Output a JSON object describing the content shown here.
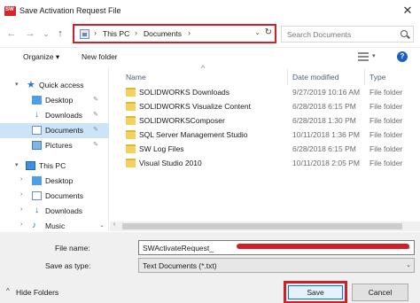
{
  "window": {
    "title": "Save Activation Request File",
    "close_glyph": "✕"
  },
  "nav": {
    "back_glyph": "←",
    "forward_glyph": "→",
    "dropdown_glyph": "⌄",
    "up_glyph": "↑",
    "breadcrumb": [
      "This PC",
      "Documents"
    ],
    "sep_glyph": "›",
    "refresh_glyph": "↻",
    "search_placeholder": "Search Documents"
  },
  "toolbar": {
    "organize_label": "Organize ▾",
    "new_folder_label": "New folder",
    "view_dd": "▾",
    "help_glyph": "?"
  },
  "sidebar": {
    "items": [
      {
        "label": "Quick access",
        "icon": "star-icon",
        "arrow": "▾"
      },
      {
        "label": "Desktop",
        "icon": "desktop-icon",
        "pin": "✎"
      },
      {
        "label": "Downloads",
        "icon": "download-icon",
        "pin": "✎"
      },
      {
        "label": "Documents",
        "icon": "documents-icon",
        "pin": "✎"
      },
      {
        "label": "Pictures",
        "icon": "pictures-icon",
        "pin": "✎"
      },
      {
        "label": "This PC",
        "icon": "computer-icon",
        "arrow": "▾"
      },
      {
        "label": "Desktop",
        "icon": "desktop-icon",
        "arrow": "›"
      },
      {
        "label": "Documents",
        "icon": "documents-icon",
        "arrow": "›"
      },
      {
        "label": "Downloads",
        "icon": "download-icon",
        "arrow": "›"
      },
      {
        "label": "Music",
        "icon": "music-icon",
        "arrow": "›"
      }
    ],
    "scroll_down_glyph": "⌄"
  },
  "files": {
    "columns": {
      "name": "Name",
      "date": "Date modified",
      "type": "Type"
    },
    "sort_glyph": "^",
    "rows": [
      {
        "name": "SOLIDWORKS Downloads",
        "date": "9/27/2019 10:16 AM",
        "type": "File folder"
      },
      {
        "name": "SOLIDWORKS Visualize Content",
        "date": "6/28/2018 6:15 PM",
        "type": "File folder"
      },
      {
        "name": "SOLIDWORKSComposer",
        "date": "6/28/2018 1:30 PM",
        "type": "File folder"
      },
      {
        "name": "SQL Server Management Studio",
        "date": "10/11/2018 1:36 PM",
        "type": "File folder"
      },
      {
        "name": "SW Log Files",
        "date": "6/28/2018 6:15 PM",
        "type": "File folder"
      },
      {
        "name": "Visual Studio 2010",
        "date": "10/11/2018 2:05 PM",
        "type": "File folder"
      }
    ],
    "scroll_left_glyph": "‹"
  },
  "form": {
    "filename_label": "File name:",
    "filename_value": "SWActivateRequest_",
    "savetype_label": "Save as type:",
    "savetype_value": "Text Documents (*.txt)",
    "dd_glyph": "⌄",
    "hide_folders_label": "Hide Folders",
    "hide_caret": "^",
    "save_label": "Save",
    "cancel_label": "Cancel"
  },
  "colors": {
    "highlight_red": "#d21f26",
    "selection_blue": "#cce4f7",
    "folder_yellow": "#f6cf5e"
  }
}
